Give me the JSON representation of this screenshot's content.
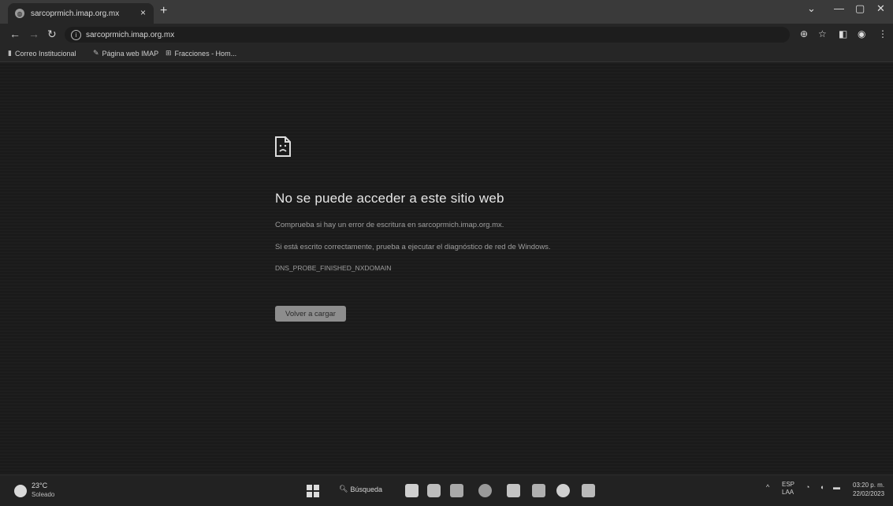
{
  "browser": {
    "tab_title": "sarcoprmich.imap.org.mx",
    "url": "sarcoprmich.imap.org.mx",
    "new_tab_symbol": "+",
    "tab_close_symbol": "×"
  },
  "bookmarks": [
    {
      "label": "Correo Institucional",
      "icon": "bookmark-icon"
    },
    {
      "label": "Página web IMAP",
      "icon": "pin-icon"
    },
    {
      "label": "Fracciones - Hom...",
      "icon": "grid-icon"
    }
  ],
  "error": {
    "title": "No se puede acceder a este sitio web",
    "line1": "Comprueba si hay un error de escritura en sarcoprmich.imap.org.mx.",
    "line2": "Si está escrito correctamente, prueba a ejecutar el diagnóstico de red de Windows.",
    "code": "DNS_PROBE_FINISHED_NXDOMAIN",
    "reload_label": "Volver a cargar"
  },
  "taskbar": {
    "weather_temp": "23°C",
    "weather_desc": "Soleado",
    "search_label": "Búsqueda",
    "lang_line1": "ESP",
    "lang_line2": "LAA",
    "time": "03:20 p. m.",
    "date": "22/02/2023"
  },
  "colors": {
    "page_bg": "#1a1a1a",
    "button_bg": "#8d8d8d",
    "title_text": "#e6e6e6",
    "body_text": "#9e9e9e"
  }
}
